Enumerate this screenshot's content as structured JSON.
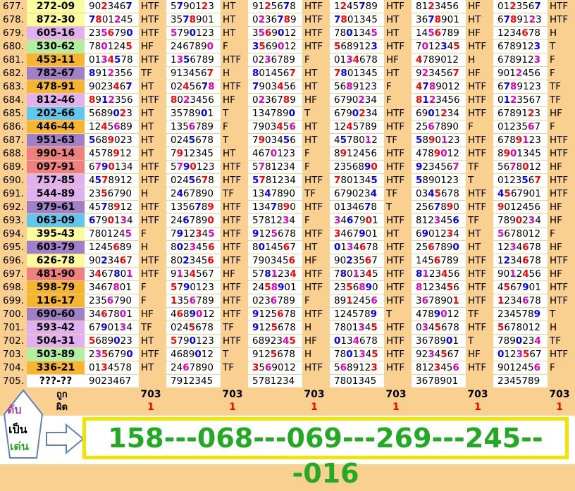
{
  "rows": [
    {
      "num": "677.",
      "pair": "272-09",
      "bg": "#fbfc9e",
      "cols": [
        [
          "9023467",
          "HTF"
        ],
        [
          "5790123",
          "HT"
        ],
        [
          "9125678",
          "HTF"
        ],
        [
          "1245789",
          "HTF"
        ],
        [
          "8123456",
          "HF"
        ],
        [
          "0123567",
          "HTF"
        ]
      ]
    },
    {
      "num": "678.",
      "pair": "872-30",
      "bg": "#fbfc9e",
      "cols": [
        [
          "7801245",
          "HTF"
        ],
        [
          "3578901",
          "HT"
        ],
        [
          "0236789",
          "HTF"
        ],
        [
          "7801345",
          "HT"
        ],
        [
          "3678901",
          "HT"
        ],
        [
          "6789123",
          "HTF"
        ]
      ]
    },
    {
      "num": "679.",
      "pair": "605-16",
      "bg": "#e0b0f0",
      "cols": [
        [
          "2356790",
          "HTF"
        ],
        [
          "5790123",
          "HT"
        ],
        [
          "3569012",
          "HTF"
        ],
        [
          "7801345",
          "HT"
        ],
        [
          "1456789",
          "HF"
        ],
        [
          "1234678",
          "H"
        ]
      ]
    },
    {
      "num": "680.",
      "pair": "530-62",
      "bg": "#b0f0a0",
      "cols": [
        [
          "7801245",
          "HF"
        ],
        [
          "2467890",
          "F"
        ],
        [
          "3569012",
          "HTF"
        ],
        [
          "5689123",
          "HTF"
        ],
        [
          "7012345",
          "HTF"
        ],
        [
          "6789123",
          "T"
        ]
      ]
    },
    {
      "num": "681.",
      "pair": "453-11",
      "bg": "#f5b530",
      "cols": [
        [
          "0134578",
          "HTF"
        ],
        [
          "1356789",
          "HTF"
        ],
        [
          "0236789",
          "F"
        ],
        [
          "0134678",
          "HF"
        ],
        [
          "4789012",
          "H"
        ],
        [
          "6789123",
          "F"
        ]
      ]
    },
    {
      "num": "682.",
      "pair": "782-67",
      "bg": "#a080c8",
      "cols": [
        [
          "8912356",
          "TF"
        ],
        [
          "9134567",
          "H"
        ],
        [
          "8014567",
          "HT"
        ],
        [
          "7801345",
          "HT"
        ],
        [
          "9234567",
          "HF"
        ],
        [
          "9012456",
          "F"
        ]
      ]
    },
    {
      "num": "683.",
      "pair": "478-91",
      "bg": "#f5b530",
      "cols": [
        [
          "9023467",
          "HT"
        ],
        [
          "0245678",
          "HTF"
        ],
        [
          "7903456",
          "HT"
        ],
        [
          "5689123",
          "F"
        ],
        [
          "4789012",
          "HTF"
        ],
        [
          "6789123",
          "TF"
        ]
      ]
    },
    {
      "num": "684.",
      "pair": "812-46",
      "bg": "#e0b0f0",
      "cols": [
        [
          "8912356",
          "HTF"
        ],
        [
          "8023456",
          "HF"
        ],
        [
          "0236789",
          "HF"
        ],
        [
          "6790234",
          "F"
        ],
        [
          "8123456",
          "HTF"
        ],
        [
          "0123567",
          "TF"
        ]
      ]
    },
    {
      "num": "685.",
      "pair": "202-66",
      "bg": "#60c8f0",
      "cols": [
        [
          "5689023",
          "HT"
        ],
        [
          "3578901",
          "T"
        ],
        [
          "1347890",
          "T"
        ],
        [
          "6790234",
          "HTF"
        ],
        [
          "6901234",
          "HTF"
        ],
        [
          "6789123",
          "HF"
        ]
      ]
    },
    {
      "num": "686.",
      "pair": "446-44",
      "bg": "#f5b530",
      "cols": [
        [
          "1245689",
          "HT"
        ],
        [
          "1356789",
          "F"
        ],
        [
          "7903456",
          "HT"
        ],
        [
          "1245789",
          "HTF"
        ],
        [
          "2567890",
          "F"
        ],
        [
          "0123567",
          "F"
        ]
      ]
    },
    {
      "num": "687.",
      "pair": "951-63",
      "bg": "#a080c8",
      "cols": [
        [
          "5689023",
          "HT"
        ],
        [
          "0245678",
          "T"
        ],
        [
          "7903456",
          "HT"
        ],
        [
          "4578012",
          "TF"
        ],
        [
          "5890123",
          "HTF"
        ],
        [
          "6789123",
          "HTF"
        ]
      ]
    },
    {
      "num": "688.",
      "pair": "990-14",
      "bg": "#f08080",
      "cols": [
        [
          "4578912",
          "HT"
        ],
        [
          "7912345",
          "HT"
        ],
        [
          "4670123",
          "F"
        ],
        [
          "8912456",
          "HTF"
        ],
        [
          "4789012",
          "HTF"
        ],
        [
          "8901345",
          "HTF"
        ]
      ]
    },
    {
      "num": "689.",
      "pair": "097-91",
      "bg": "#f08080",
      "cols": [
        [
          "6790134",
          "HTF"
        ],
        [
          "5790123",
          "HTF"
        ],
        [
          "5781234",
          "F"
        ],
        [
          "2356890",
          "HTF"
        ],
        [
          "9234567",
          "TF"
        ],
        [
          "5678012",
          "HF"
        ]
      ]
    },
    {
      "num": "690.",
      "pair": "757-85",
      "bg": "#e0b0f0",
      "cols": [
        [
          "4578912",
          "HTF"
        ],
        [
          "0245678",
          "HTF"
        ],
        [
          "5781234",
          "HTF"
        ],
        [
          "7801345",
          "HTF"
        ],
        [
          "5890123",
          "T"
        ],
        [
          "0123567",
          "HTF"
        ]
      ]
    },
    {
      "num": "691.",
      "pair": "544-89",
      "bg": "#e0b0f0",
      "cols": [
        [
          "2356790",
          "H"
        ],
        [
          "2467890",
          "TF"
        ],
        [
          "1347890",
          "TF"
        ],
        [
          "6790234",
          "TF"
        ],
        [
          "0345678",
          "HTF"
        ],
        [
          "4567901",
          "HTF"
        ]
      ]
    },
    {
      "num": "692.",
      "pair": "979-61",
      "bg": "#a080c8",
      "cols": [
        [
          "4578912",
          "HTF"
        ],
        [
          "1356789",
          "HTF"
        ],
        [
          "1347890",
          "HTF"
        ],
        [
          "0134678",
          "T"
        ],
        [
          "2567890",
          "HTF"
        ],
        [
          "9012456",
          "HF"
        ]
      ]
    },
    {
      "num": "693.",
      "pair": "063-09",
      "bg": "#60c8f0",
      "cols": [
        [
          "6790134",
          "HTF"
        ],
        [
          "2467890",
          "HTF"
        ],
        [
          "5781234",
          "F"
        ],
        [
          "3467901",
          "HTF"
        ],
        [
          "8123456",
          "TF"
        ],
        [
          "7890234",
          "HF"
        ]
      ]
    },
    {
      "num": "694.",
      "pair": "395-43",
      "bg": "#fbfc9e",
      "cols": [
        [
          "7801245",
          "F"
        ],
        [
          "7912345",
          "HTF"
        ],
        [
          "9125678",
          "HTF"
        ],
        [
          "3467901",
          "HT"
        ],
        [
          "6901234",
          "HT"
        ],
        [
          "5678012",
          "F"
        ]
      ]
    },
    {
      "num": "695.",
      "pair": "603-79",
      "bg": "#a080c8",
      "cols": [
        [
          "1245689",
          "H"
        ],
        [
          "8023456",
          "HTF"
        ],
        [
          "8014567",
          "HT"
        ],
        [
          "0134678",
          "HTF"
        ],
        [
          "2567890",
          "HT"
        ],
        [
          "1234678",
          "HF"
        ]
      ]
    },
    {
      "num": "696.",
      "pair": "626-78",
      "bg": "#fbfc9e",
      "cols": [
        [
          "9023467",
          "HTF"
        ],
        [
          "8023456",
          "HTF"
        ],
        [
          "7903456",
          "HF"
        ],
        [
          "9023567",
          "HTF"
        ],
        [
          "1456789",
          "HTF"
        ],
        [
          "1234678",
          "HTF"
        ]
      ]
    },
    {
      "num": "697.",
      "pair": "481-90",
      "bg": "#f08080",
      "cols": [
        [
          "3467801",
          "HTF"
        ],
        [
          "9134567",
          "HF"
        ],
        [
          "5781234",
          "HTF"
        ],
        [
          "7801345",
          "HTF"
        ],
        [
          "8123456",
          "HTF"
        ],
        [
          "9012456",
          "HF"
        ]
      ]
    },
    {
      "num": "698.",
      "pair": "598-79",
      "bg": "#f5b530",
      "cols": [
        [
          "3467801",
          "F"
        ],
        [
          "5790123",
          "HTF"
        ],
        [
          "2458901",
          "HTF"
        ],
        [
          "2356890",
          "HTF"
        ],
        [
          "8123456",
          "HTF"
        ],
        [
          "4567901",
          "HTF"
        ]
      ]
    },
    {
      "num": "699.",
      "pair": "116-17",
      "bg": "#f5b530",
      "cols": [
        [
          "2356790",
          "F"
        ],
        [
          "1356789",
          "HTF"
        ],
        [
          "0236789",
          "F"
        ],
        [
          "8912456",
          "HTF"
        ],
        [
          "3678901",
          "HTF"
        ],
        [
          "1234678",
          "HTF"
        ]
      ]
    },
    {
      "num": "700.",
      "pair": "690-60",
      "bg": "#a080c8",
      "cols": [
        [
          "3467801",
          "HF"
        ],
        [
          "4689012",
          "HTF"
        ],
        [
          "9125678",
          "HTF"
        ],
        [
          "1245789",
          "T"
        ],
        [
          "4789012",
          "TF"
        ],
        [
          "2345789",
          "T"
        ]
      ]
    },
    {
      "num": "701.",
      "pair": "593-42",
      "bg": "#e0b0f0",
      "cols": [
        [
          "6790134",
          "TF"
        ],
        [
          "0245678",
          "TF"
        ],
        [
          "9125678",
          "H"
        ],
        [
          "7801345",
          "HTF"
        ],
        [
          "0345678",
          "HTF"
        ],
        [
          "5678012",
          "H"
        ]
      ]
    },
    {
      "num": "702.",
      "pair": "504-31",
      "bg": "#e0b0f0",
      "cols": [
        [
          "5689023",
          "HT"
        ],
        [
          "5790123",
          "HTF"
        ],
        [
          "6892345",
          "HF"
        ],
        [
          "0134678",
          "HTF"
        ],
        [
          "3678901",
          "T"
        ],
        [
          "7890234",
          "TF"
        ]
      ]
    },
    {
      "num": "703.",
      "pair": "503-89",
      "bg": "#b0f0a0",
      "cols": [
        [
          "2356790",
          "HTF"
        ],
        [
          "4689012",
          "T"
        ],
        [
          "9125678",
          "H"
        ],
        [
          "7801345",
          "HTF"
        ],
        [
          "9234567",
          "HF"
        ],
        [
          "0123567",
          "HTF"
        ]
      ]
    },
    {
      "num": "704.",
      "pair": "336-21",
      "bg": "#f5b530",
      "cols": [
        [
          "0134578",
          "HT"
        ],
        [
          "2467890",
          "TF"
        ],
        [
          "3569012",
          "HTF"
        ],
        [
          "5689123",
          "HTF"
        ],
        [
          "8123456",
          "HTF"
        ],
        [
          "9012456",
          "F"
        ]
      ]
    },
    {
      "num": "705.",
      "pair": "???-??",
      "bg": "#ffffff",
      "cols": [
        [
          "9023467",
          ""
        ],
        [
          "7912345",
          ""
        ],
        [
          "5781234",
          ""
        ],
        [
          "7801345",
          ""
        ],
        [
          "3678901",
          ""
        ],
        [
          "2345789",
          ""
        ]
      ]
    }
  ],
  "summary": {
    "label_hit": "ถูก",
    "label_miss": "ผิด",
    "hits": [
      "703",
      "703",
      "703",
      "703",
      "703",
      "703"
    ],
    "misses": [
      "1",
      "1",
      "1",
      "1",
      "1",
      "1"
    ]
  },
  "badge": {
    "top": "ดับ",
    "mid": "เป็น",
    "bot": "เด่น"
  },
  "result": "158---068---069---269---245---016",
  "colors": {
    "page": "#f9d08f",
    "result": "#22aa22",
    "box_border": "#f2e400",
    "red": "#ff0000",
    "blue": "#0000ff",
    "pink": "#e000c0"
  }
}
